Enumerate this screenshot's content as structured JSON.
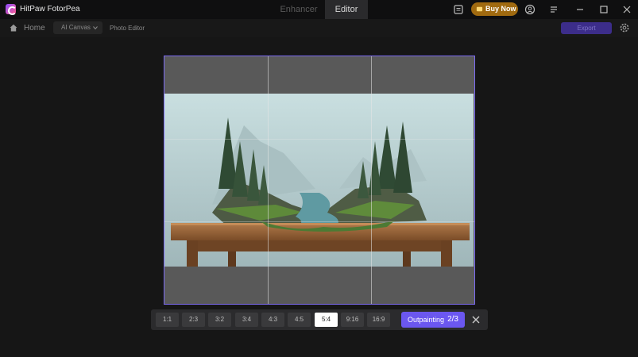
{
  "titlebar": {
    "app_name": "HitPaw FotorPea",
    "modes": [
      "Enhancer",
      "Editor"
    ],
    "buy_now": "Buy Now",
    "icons": [
      "logo-icon",
      "notes-icon",
      "cart-icon",
      "account-icon",
      "menu-icon",
      "minimize-icon",
      "maximize-icon",
      "close-icon"
    ]
  },
  "navbar": {
    "home": "Home",
    "canvas_dropdown": "AI Canvas",
    "photo_editor": "Photo Editor",
    "export": "Export"
  },
  "toolbar": {
    "ratios": [
      "1:1",
      "2:3",
      "3:2",
      "3:4",
      "4:3",
      "4:5",
      "5:4",
      "9:16",
      "16:9"
    ],
    "active_ratio": "5:4",
    "outpainting_label": "Outpainting",
    "outpainting_count": "2/3"
  },
  "colors": {
    "accent": "#6b57f0",
    "frame_border": "#7b6af0",
    "buy_now_bg": "#a06a10"
  }
}
